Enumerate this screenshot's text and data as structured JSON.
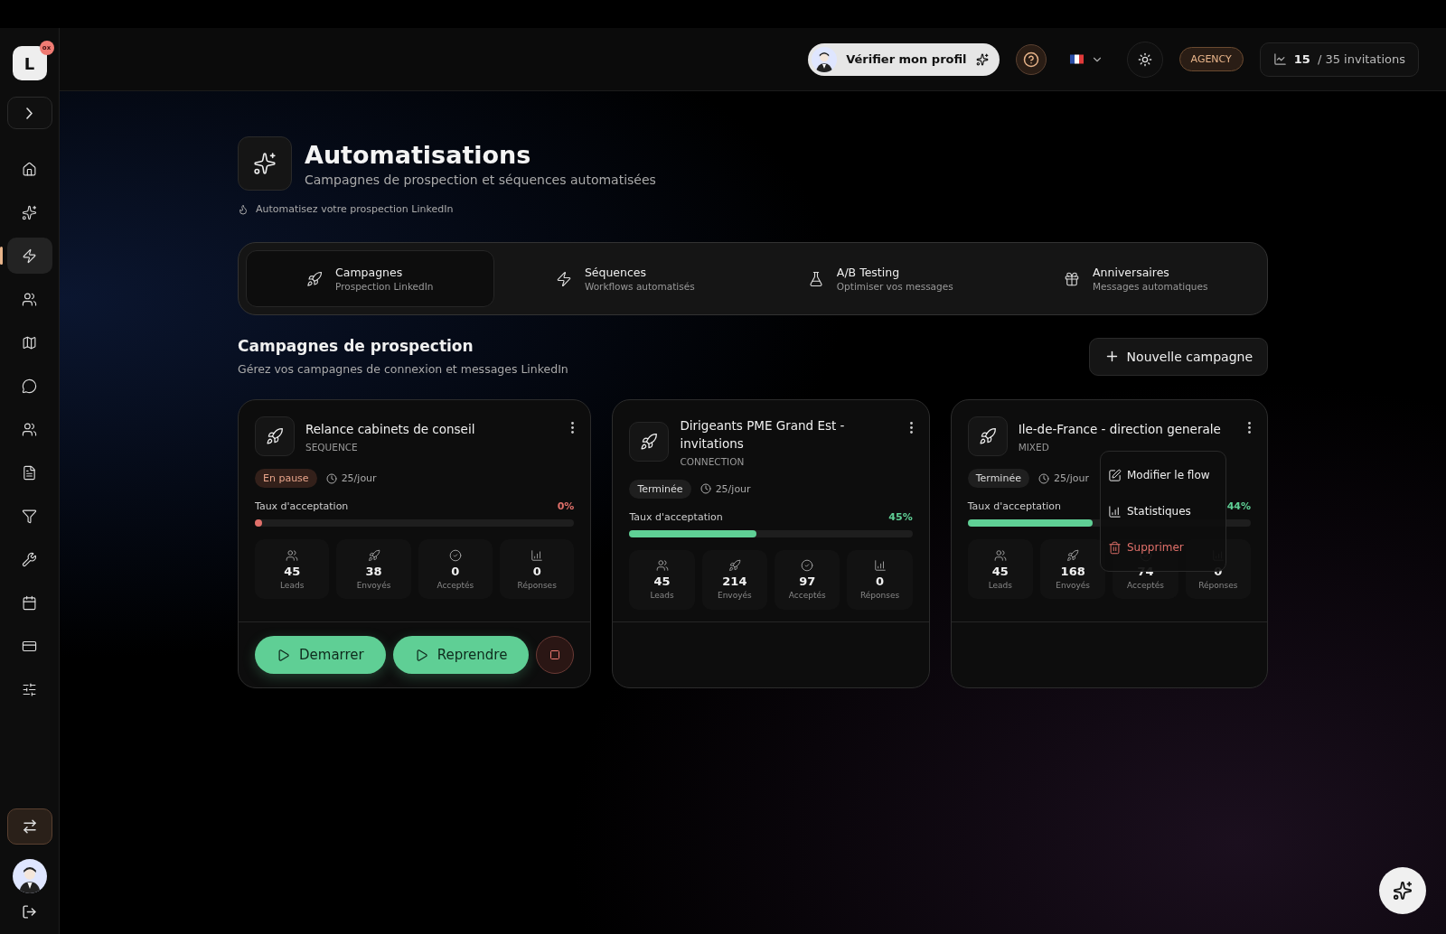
{
  "sidebar": {
    "logo": "L",
    "badge": "ox",
    "items": [
      {
        "kind": "home",
        "selected": false
      },
      {
        "kind": "sparkles",
        "selected": false
      },
      {
        "kind": "zap",
        "selected": true
      },
      {
        "kind": "users",
        "selected": false
      },
      {
        "kind": "map",
        "selected": false
      },
      {
        "kind": "chat",
        "selected": false
      },
      {
        "kind": "users",
        "selected": false
      },
      {
        "kind": "file",
        "selected": false
      },
      {
        "kind": "filter",
        "selected": false
      },
      {
        "kind": "wrench",
        "selected": false
      },
      {
        "kind": "calendar",
        "selected": false
      },
      {
        "kind": "card",
        "selected": false
      },
      {
        "kind": "sliders",
        "selected": false
      }
    ]
  },
  "header": {
    "verify_button": "Vérifier mon profil",
    "plan": "AGENCY",
    "invitations_used": "15",
    "invitations_total": "/ 35 invitations"
  },
  "page": {
    "title": "Automatisations",
    "subtitle": "Campagnes de prospection et séquences automatisées",
    "note": "Automatisez votre prospection LinkedIn"
  },
  "tabs": [
    {
      "kind": "rocket",
      "title": "Campagnes",
      "subtitle": "Prospection LinkedIn",
      "selected": true
    },
    {
      "kind": "zap",
      "title": "Séquences",
      "subtitle": "Workflows automatisés",
      "selected": false
    },
    {
      "kind": "flask",
      "title": "A/B Testing",
      "subtitle": "Optimiser vos messages",
      "selected": false
    },
    {
      "kind": "gift",
      "title": "Anniversaires",
      "subtitle": "Messages automatiques",
      "selected": false
    }
  ],
  "section": {
    "title": "Campagnes de prospection",
    "subtitle": "Gérez vos campagnes de connexion et messages LinkedIn",
    "new_button": "Nouvelle campagne"
  },
  "campaigns": [
    {
      "name": "Relance cabinets de conseil",
      "type": "SEQUENCE",
      "status": {
        "label": "En pause",
        "kind": "paused"
      },
      "rate_per_day": "25/jour",
      "rate_label": "Taux d'acceptation",
      "rate": "0%",
      "level": 0,
      "stats": [
        {
          "kind": "users",
          "value": "45",
          "label": "Leads"
        },
        {
          "kind": "rocket",
          "value": "38",
          "label": "Envoyés"
        },
        {
          "kind": "check",
          "value": "0",
          "label": "Acceptés"
        },
        {
          "kind": "bars",
          "value": "0",
          "label": "Réponses"
        }
      ],
      "actions": [
        {
          "kind": "play",
          "label": "Demarrer"
        },
        {
          "kind": "play",
          "label": "Reprendre"
        },
        {
          "kind": "stop"
        }
      ]
    },
    {
      "name": "Dirigeants PME Grand Est - invitations",
      "type": "CONNECTION",
      "status": {
        "label": "Terminée",
        "kind": "done"
      },
      "rate_per_day": "25/jour",
      "rate_label": "Taux d'acceptation",
      "rate": "45%",
      "level": 0.45,
      "stats": [
        {
          "kind": "users",
          "value": "45",
          "label": "Leads"
        },
        {
          "kind": "rocket",
          "value": "214",
          "label": "Envoyés"
        },
        {
          "kind": "check",
          "value": "97",
          "label": "Acceptés"
        },
        {
          "kind": "bars",
          "value": "0",
          "label": "Réponses"
        }
      ]
    },
    {
      "name": "Ile-de-France - direction generale",
      "type": "MIXED",
      "status": {
        "label": "Terminée",
        "kind": "done"
      },
      "rate_per_day": "25/jour",
      "rate_label": "Taux d'acceptation",
      "rate": "44%",
      "level": 0.44,
      "stats": [
        {
          "kind": "users",
          "value": "45",
          "label": "Leads"
        },
        {
          "kind": "rocket",
          "value": "168",
          "label": "Envoyés"
        },
        {
          "kind": "check",
          "value": "74",
          "label": "Acceptés"
        },
        {
          "kind": "bars",
          "value": "0",
          "label": "Réponses"
        }
      ],
      "menu": [
        {
          "kind": "edit",
          "label": "Modifier le flow"
        },
        {
          "kind": "stats",
          "label": "Statistiques"
        },
        {
          "kind": "delete",
          "label": "Supprimer"
        }
      ]
    }
  ]
}
